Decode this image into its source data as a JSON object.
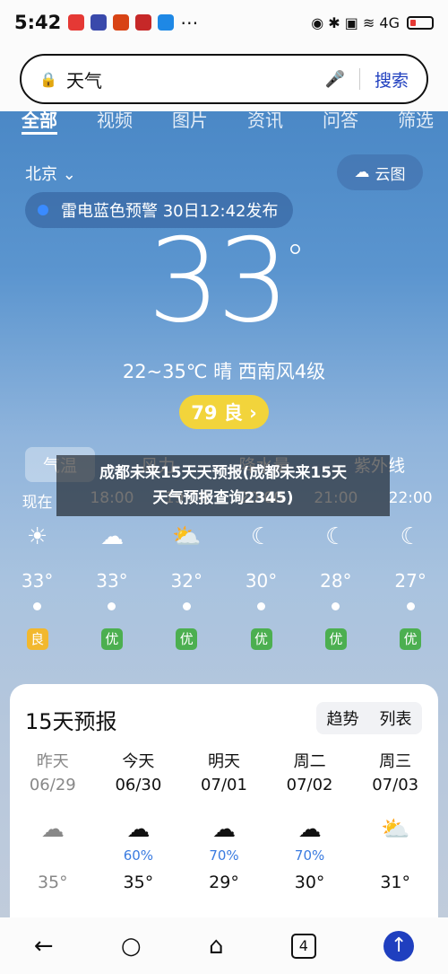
{
  "status": {
    "time": "5:42",
    "icons": "⋯",
    "right": "◉ ✱ ▣ ≋ 4G"
  },
  "search": {
    "query": "天气",
    "button": "搜索"
  },
  "tabs": [
    "全部",
    "视频",
    "图片",
    "资讯",
    "问答",
    "筛选"
  ],
  "location": {
    "city": "北京 ⌄",
    "cloud_map": "云图"
  },
  "alert": {
    "text": "雷电蓝色预警  30日12:42发布"
  },
  "current": {
    "temp": "33",
    "deg": "°",
    "summary": "22~35℃ 晴 西南风4级",
    "aqi": "79 良 ›"
  },
  "subtabs": [
    "气温",
    "风力",
    "降水量",
    "紫外线"
  ],
  "overlay": {
    "line1": "成都未来15天天预报(成都未来15天",
    "line2": "天气预报查询2345)"
  },
  "hourly": [
    {
      "time": "现在",
      "icon": "☀",
      "temp": "33°",
      "q": "良",
      "qcolor": "#f2b82e"
    },
    {
      "time": "18:00",
      "icon": "☁",
      "temp": "33°",
      "q": "优",
      "qcolor": "#4caf50"
    },
    {
      "time": "19:00",
      "icon": "⛅",
      "temp": "32°",
      "q": "优",
      "qcolor": "#4caf50"
    },
    {
      "time": "20:00",
      "icon": "☾",
      "temp": "30°",
      "q": "优",
      "qcolor": "#4caf50"
    },
    {
      "time": "21:00",
      "icon": "☾",
      "temp": "28°",
      "q": "优",
      "qcolor": "#4caf50"
    },
    {
      "time": "22:00",
      "icon": "☾",
      "temp": "27°",
      "q": "优",
      "qcolor": "#4caf50"
    }
  ],
  "forecast": {
    "title": "15天预报",
    "toggle": [
      "趋势",
      "列表"
    ],
    "days": [
      {
        "name": "昨天",
        "date": "06/29",
        "icon": "☁",
        "pct": "",
        "temp": "35°"
      },
      {
        "name": "今天",
        "date": "06/30",
        "icon": "☁",
        "pct": "60%",
        "temp": "35°"
      },
      {
        "name": "明天",
        "date": "07/01",
        "icon": "☁",
        "pct": "70%",
        "temp": "29°"
      },
      {
        "name": "周二",
        "date": "07/02",
        "icon": "☁",
        "pct": "70%",
        "temp": "30°"
      },
      {
        "name": "周三",
        "date": "07/03",
        "icon": "⛅",
        "pct": "",
        "temp": "31°"
      }
    ]
  },
  "nav": {
    "back": "←",
    "search": "○",
    "home": "⌂",
    "tabs": "4",
    "up": "↑"
  }
}
